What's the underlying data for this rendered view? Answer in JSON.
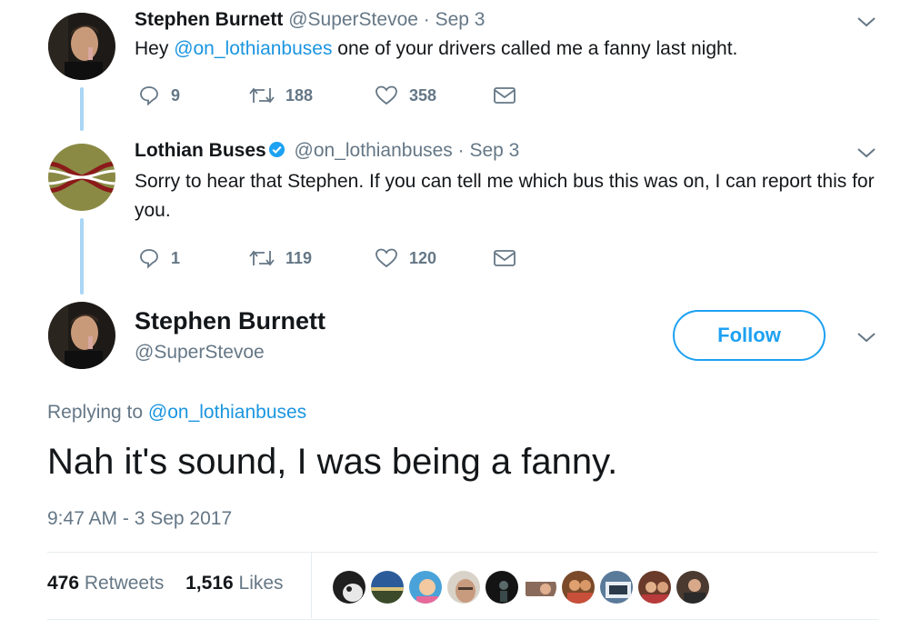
{
  "tweets": [
    {
      "author_name": "Stephen Burnett",
      "author_handle": "@SuperStevoe",
      "date": "· Sep 3",
      "text_before": "Hey ",
      "mention": "@on_lothianbuses",
      "text_after": " one of your drivers called me a fanny last night.",
      "replies": "9",
      "retweets": "188",
      "likes": "358"
    },
    {
      "author_name": "Lothian Buses",
      "author_handle": "@on_lothianbuses",
      "date": "· Sep 3",
      "verified": true,
      "text": "Sorry to hear that Stephen. If you can tell me which bus this was on, I can report this for you.",
      "replies": "1",
      "retweets": "119",
      "likes": "120"
    }
  ],
  "focus_tweet": {
    "author_name": "Stephen Burnett",
    "author_handle": "@SuperStevoe",
    "follow_label": "Follow",
    "replying_to_label": "Replying to",
    "replying_to_handle": "@on_lothianbuses",
    "text": "Nah it's sound, I was being a fanny.",
    "timestamp": "9:47 AM - 3 Sep 2017",
    "retweets_count": "476",
    "retweets_label": "Retweets",
    "likes_count": "1,516",
    "likes_label": "Likes",
    "liker_avatar_count": 10
  },
  "icons": {
    "reply": "reply-icon",
    "retweet": "retweet-icon",
    "like": "heart-icon",
    "dm": "envelope-icon",
    "menu": "chevron-down-icon",
    "verified": "verified-badge-icon"
  },
  "colors": {
    "link": "#1b95e0",
    "follow": "#1da1f2",
    "secondary_text": "#657786",
    "thread_line": "#a9d6f5",
    "lothian_logo_bg": "#8a8a45",
    "lothian_logo_stripe": "#8b1a1a"
  }
}
